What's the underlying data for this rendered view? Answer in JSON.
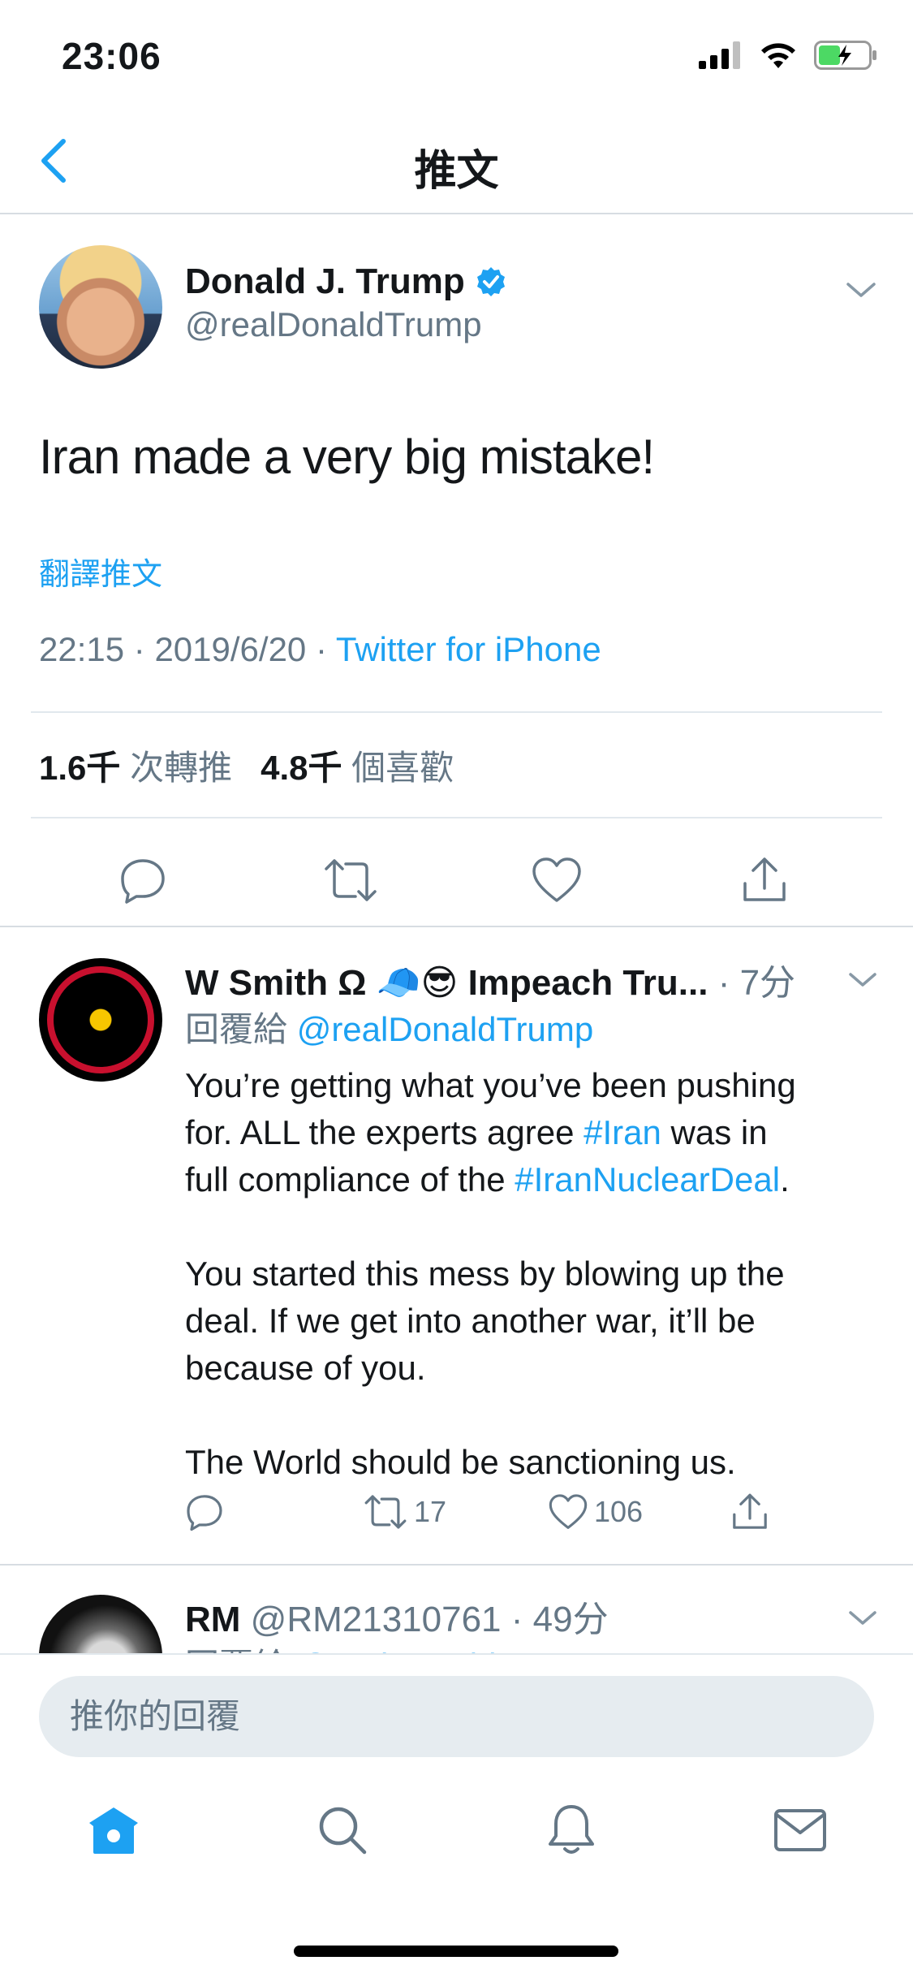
{
  "status_bar": {
    "time": "23:06"
  },
  "nav": {
    "title": "推文"
  },
  "tweet": {
    "author_name": "Donald J. Trump",
    "author_handle": "@realDonaldTrump",
    "text": "Iran made a very big mistake!",
    "translate_label": "翻譯推文",
    "time": "22:15",
    "date": "2019/6/20",
    "source": "Twitter for iPhone",
    "retweet_count": "1.6千",
    "retweet_label": "次轉推",
    "like_count": "4.8千",
    "like_label": "個喜歡"
  },
  "replies": [
    {
      "name": "W Smith Ω 🧢😎 Impeach Tru...",
      "time": "· 7分",
      "reply_to_label": "回覆給",
      "reply_to_handle": "@realDonaldTrump",
      "line1a": "You’re getting what you’ve been pushing",
      "line2a": "for.  ALL the experts agree ",
      "tag1": "#Iran",
      "line2b": " was in",
      "line3a": "full compliance of the ",
      "tag2": "#IranNuclearDeal",
      "line3b": ".",
      "para2_line1": "You started this mess by blowing up the",
      "para2_line2": "deal. If we get into another war, it’ll be",
      "para2_line3": "because of you.",
      "para3": "The World should be sanctioning us.",
      "retweets": "17",
      "likes": "106"
    },
    {
      "name": "RM",
      "handle": "@RM21310761",
      "time": "· 49分",
      "reply_to_label": "回覆給",
      "reply_to_handle": "@realDonaldTrump"
    }
  ],
  "composer": {
    "placeholder": "推你的回覆"
  },
  "tab_bar": {
    "items": [
      "home-icon",
      "search-icon",
      "bell-icon",
      "mail-icon"
    ]
  },
  "colors": {
    "accent": "#1da1f2",
    "muted": "#657786",
    "text": "#14171a"
  }
}
